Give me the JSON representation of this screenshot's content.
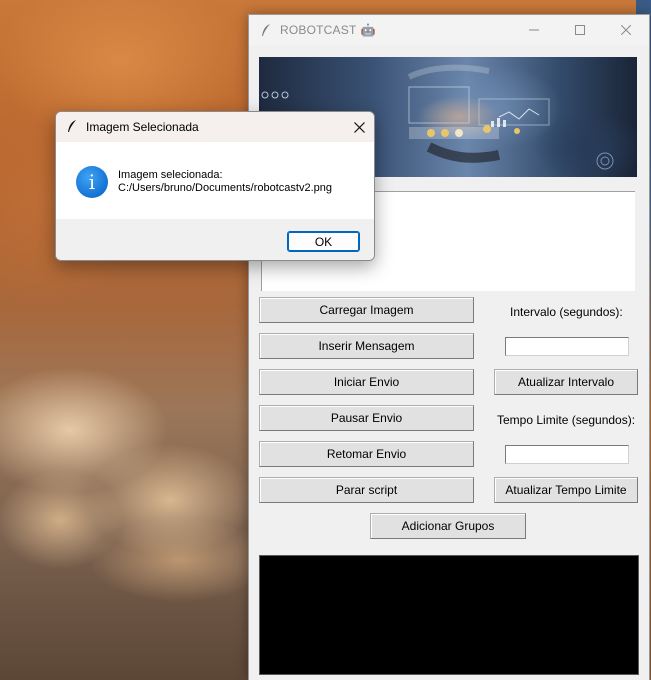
{
  "app": {
    "title": "ROBOTCAST",
    "title_emoji": "🤖",
    "icons": {
      "app": "feather-icon",
      "minimize": "minimize-icon",
      "maximize": "maximize-icon",
      "close": "close-icon"
    }
  },
  "buttons": {
    "load_image": "Carregar Imagem",
    "insert_message": "Inserir Mensagem",
    "start_send": "Iniciar Envio",
    "pause_send": "Pausar Envio",
    "resume_send": "Retomar Envio",
    "stop_script": "Parar script",
    "update_interval": "Atualizar Intervalo",
    "update_time_limit": "Atualizar Tempo Limite",
    "add_groups": "Adicionar Grupos"
  },
  "labels": {
    "interval": "Intervalo (segundos):",
    "time_limit": "Tempo Limite (segundos):"
  },
  "inputs": {
    "interval_value": "",
    "time_limit_value": ""
  },
  "dialog": {
    "title": "Imagem Selecionada",
    "message_line1": "Imagem selecionada:",
    "message_line2": "C:/Users/bruno/Documents/robotcastv2.png",
    "ok_label": "OK",
    "icon": "info-icon",
    "icon_glyph": "i"
  },
  "colors": {
    "console_bg": "#000000",
    "ok_border": "#0067c0",
    "info_icon": "#1472d3"
  }
}
